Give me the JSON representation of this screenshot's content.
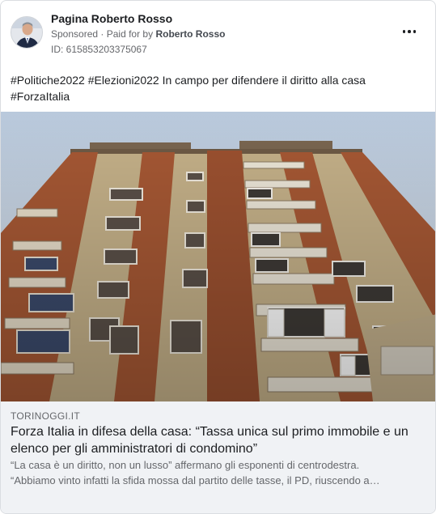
{
  "post": {
    "page_name": "Pagina Roberto Rosso",
    "sponsored_label": "Sponsored",
    "paid_for_prefix": "Paid for by",
    "paid_for_name": "Roberto Rosso",
    "ad_id": "ID: 615853203375067",
    "text_line1": "#Politiche2022 #Elezioni2022 In campo per difendere il diritto alla casa",
    "text_line2": "#ForzaItalia",
    "more_icon": "more-horizontal-icon"
  },
  "link": {
    "domain": "TORINOGGI.IT",
    "title": "Forza Italia in difesa della casa: “Tassa unica sul primo immobile e un elenco per gli amministratori di condomino”",
    "desc_line1": "“La casa è un diritto, non un lusso” affermano gli esponenti di centrodestra.",
    "desc_line2": "“Abbiamo vinto infatti la sfida mossa dal partito delle tasse, il PD, riuscendo a…"
  },
  "colors": {
    "text_primary": "#1c1e21",
    "text_secondary": "#65676b",
    "link_bg": "#f0f2f5",
    "facade_brick": "#a85a3a",
    "facade_beige": "#c8b48e",
    "sky": "#c9d6e4"
  }
}
